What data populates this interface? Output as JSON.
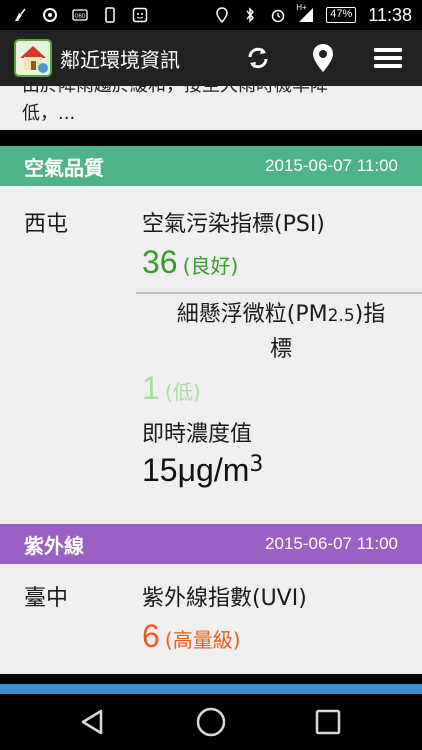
{
  "status_bar": {
    "time": "11:38",
    "battery": "47%",
    "network": "H+"
  },
  "app_bar": {
    "title": "鄰近環境資訊",
    "icons": [
      "refresh-icon",
      "location-pin-icon",
      "menu-icon"
    ]
  },
  "top_snippet": {
    "line1": "由於降雨趨於緩和，接至大雨時機率降",
    "line2": "低，..."
  },
  "air_quality": {
    "header": "空氣品質",
    "datetime": "2015-06-07 11:00",
    "header_color": "#4fb38a",
    "location": "西屯",
    "psi_label": "空氣污染指標(PSI)",
    "psi_value": "36",
    "psi_level": "(良好)",
    "psi_color": "#3a9a2e",
    "pm25_label_a": "細懸浮微粒(PM",
    "pm25_label_sub": "2.5",
    "pm25_label_b": ")指",
    "pm25_label_c": "標",
    "pm25_value": "1",
    "pm25_level": "(低)",
    "pm25_color": "#a8e0a0",
    "realtime_label": "即時濃度值",
    "realtime_value": "15μg/m",
    "realtime_sup": "3"
  },
  "uv": {
    "header": "紫外線",
    "datetime": "2015-06-07 11:00",
    "header_color": "#9a60c4",
    "location": "臺中",
    "uvi_label": "紫外線指數(UVI)",
    "uvi_value": "6",
    "uvi_level": "(高量級)",
    "uvi_color": "#f05a1e"
  },
  "next_section_color": "#3a8fd0",
  "nav": {
    "icons": [
      "back-icon",
      "home-icon",
      "recents-icon"
    ]
  }
}
